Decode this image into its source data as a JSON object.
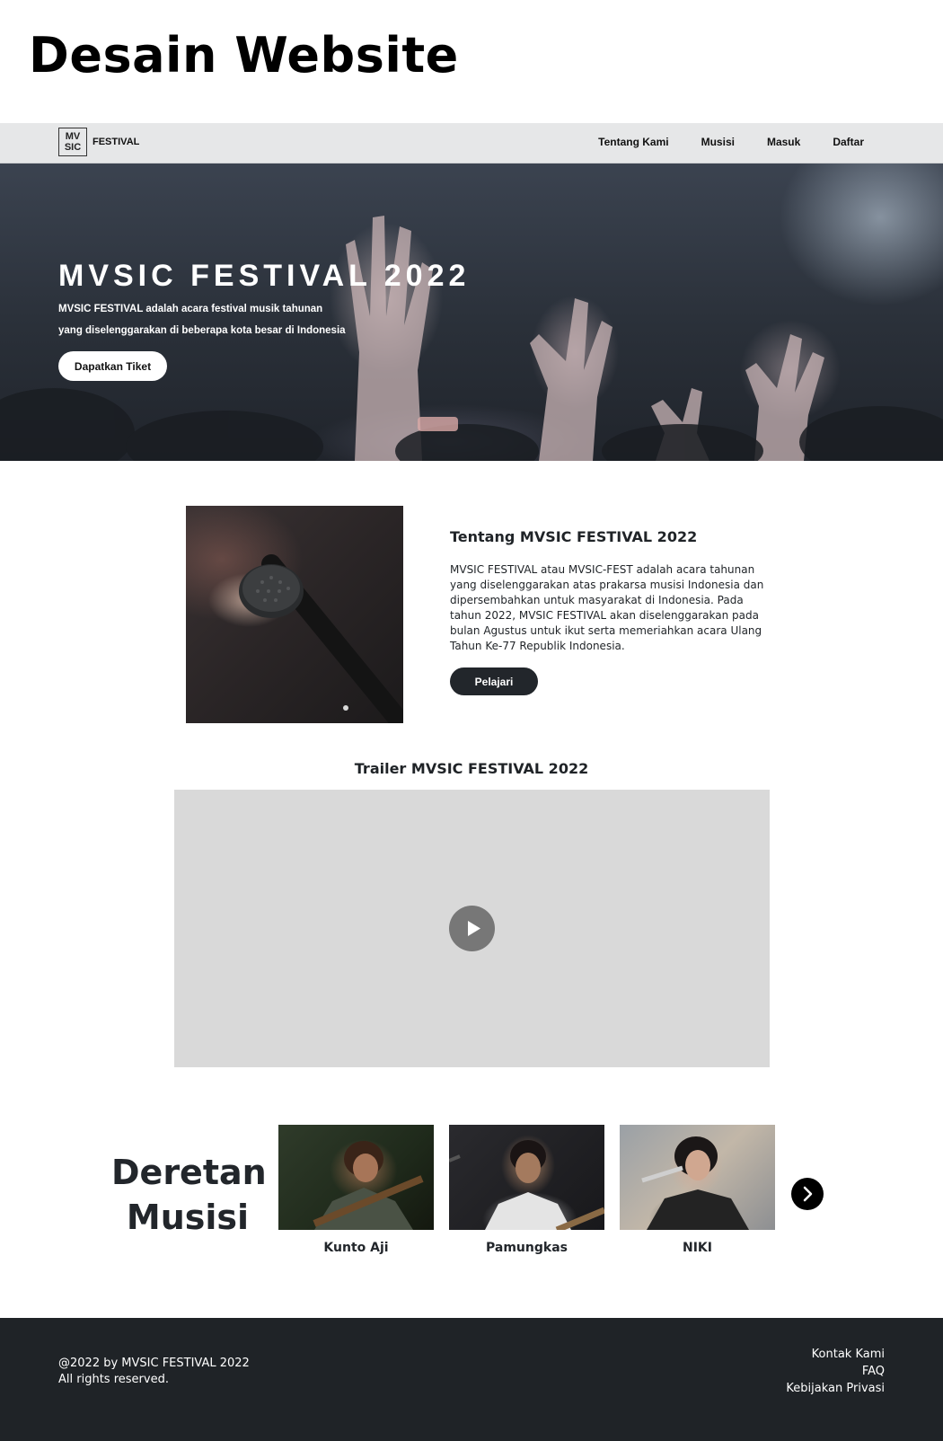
{
  "page": {
    "heading": "Desain Website"
  },
  "navbar": {
    "logo_line1": "MV",
    "logo_line2": "SIC",
    "logo_text": "FESTIVAL",
    "links": [
      "Tentang Kami",
      "Musisi",
      "Masuk",
      "Daftar"
    ]
  },
  "hero": {
    "title": "MVSIC FESTIVAL 2022",
    "line1": "MVSIC FESTIVAL adalah acara festival musik tahunan",
    "line2": "yang diselenggarakan di beberapa kota besar di Indonesia",
    "cta": "Dapatkan Tiket"
  },
  "about": {
    "title": "Tentang MVSIC FESTIVAL 2022",
    "text": "MVSIC FESTIVAL atau MVSIC-FEST adalah acara tahunan yang diselenggarakan atas prakarsa musisi Indonesia dan dipersembahkan untuk masyarakat di Indonesia. Pada tahun 2022, MVSIC FESTIVAL akan diselenggarakan pada bulan Agustus untuk ikut serta memeriahkan acara Ulang Tahun Ke-77 Republik Indonesia.",
    "button": "Pelajari",
    "image_icon": "microphone-photo"
  },
  "trailer": {
    "title": "Trailer MVSIC FESTIVAL 2022",
    "play_icon": "play-icon"
  },
  "musicians": {
    "heading_line1": "Deretan",
    "heading_line2": "Musisi",
    "items": [
      {
        "name": "Kunto Aji"
      },
      {
        "name": "Pamungkas"
      },
      {
        "name": "NIKI"
      }
    ],
    "next_icon": "chevron-right-icon"
  },
  "footer": {
    "copyright_line1": "@2022 by MVSIC FESTIVAL 2022",
    "copyright_line2": "All rights reserved.",
    "links": [
      "Kontak Kami",
      "FAQ",
      "Kebijakan Privasi"
    ]
  },
  "colors": {
    "dark": "#1f2327",
    "navbar_bg": "#e6e7e8",
    "video_placeholder": "#d9d9d9",
    "play_button": "#777777"
  }
}
